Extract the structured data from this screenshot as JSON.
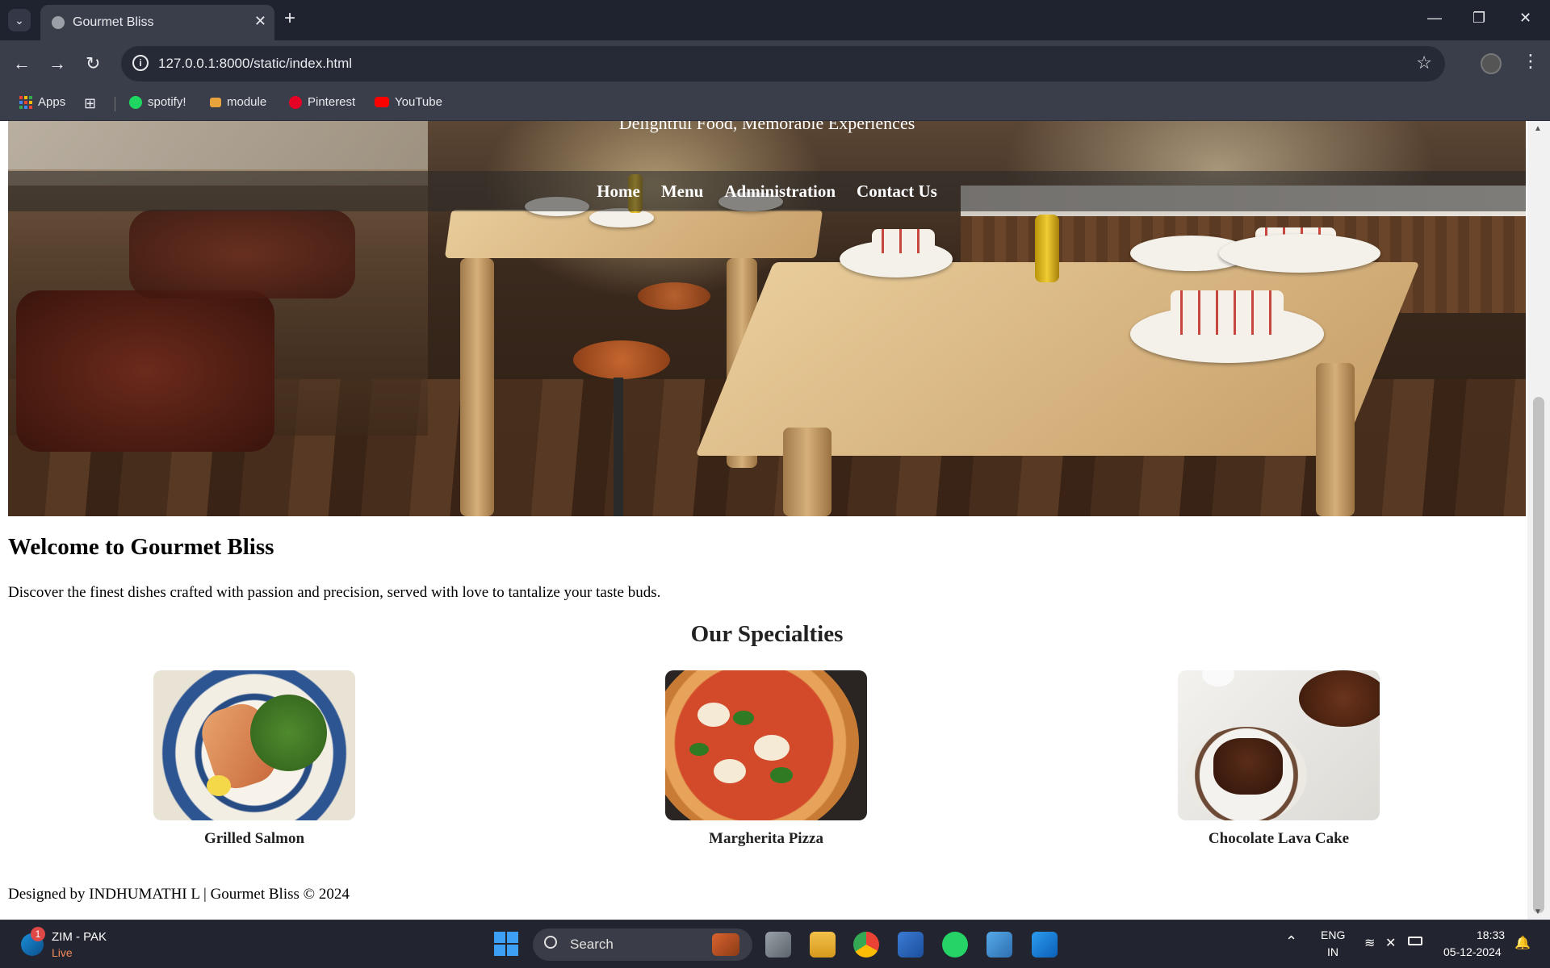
{
  "browser": {
    "tab_title": "Gourmet Bliss",
    "tab_close": "✕",
    "new_tab": "+",
    "url": "127.0.0.1:8000/static/index.html",
    "bookmarks": [
      "Apps",
      "spotify!",
      "module",
      "Pinterest",
      "YouTube"
    ]
  },
  "page": {
    "tagline": "Delightful Food, Memorable Experiences",
    "nav": [
      "Home",
      "Menu",
      "Administration",
      "Contact Us"
    ],
    "welcome_heading": "Welcome to Gourmet Bliss",
    "intro": "Discover the finest dishes crafted with passion and precision, served with love to tantalize your taste buds.",
    "specialties_heading": "Our Specialties",
    "specialties": [
      {
        "name": "Grilled Salmon"
      },
      {
        "name": "Margherita Pizza"
      },
      {
        "name": "Chocolate Lava Cake"
      }
    ],
    "footer": "Designed by INDHUMATHI L | Gourmet Bliss © 2024"
  },
  "taskbar": {
    "weather_title": "ZIM - PAK",
    "weather_sub": "Live",
    "weather_badge": "1",
    "search_placeholder": "Search",
    "lang_top": "ENG",
    "lang_bottom": "IN",
    "time": "18:33",
    "date": "05-12-2024"
  },
  "colors": {
    "chrome_bg": "#1f2330",
    "toolbar_bg": "#3a3e4b",
    "taskbar_bg": "#22252f",
    "nav_overlay": "rgba(40,40,40,.55)"
  }
}
